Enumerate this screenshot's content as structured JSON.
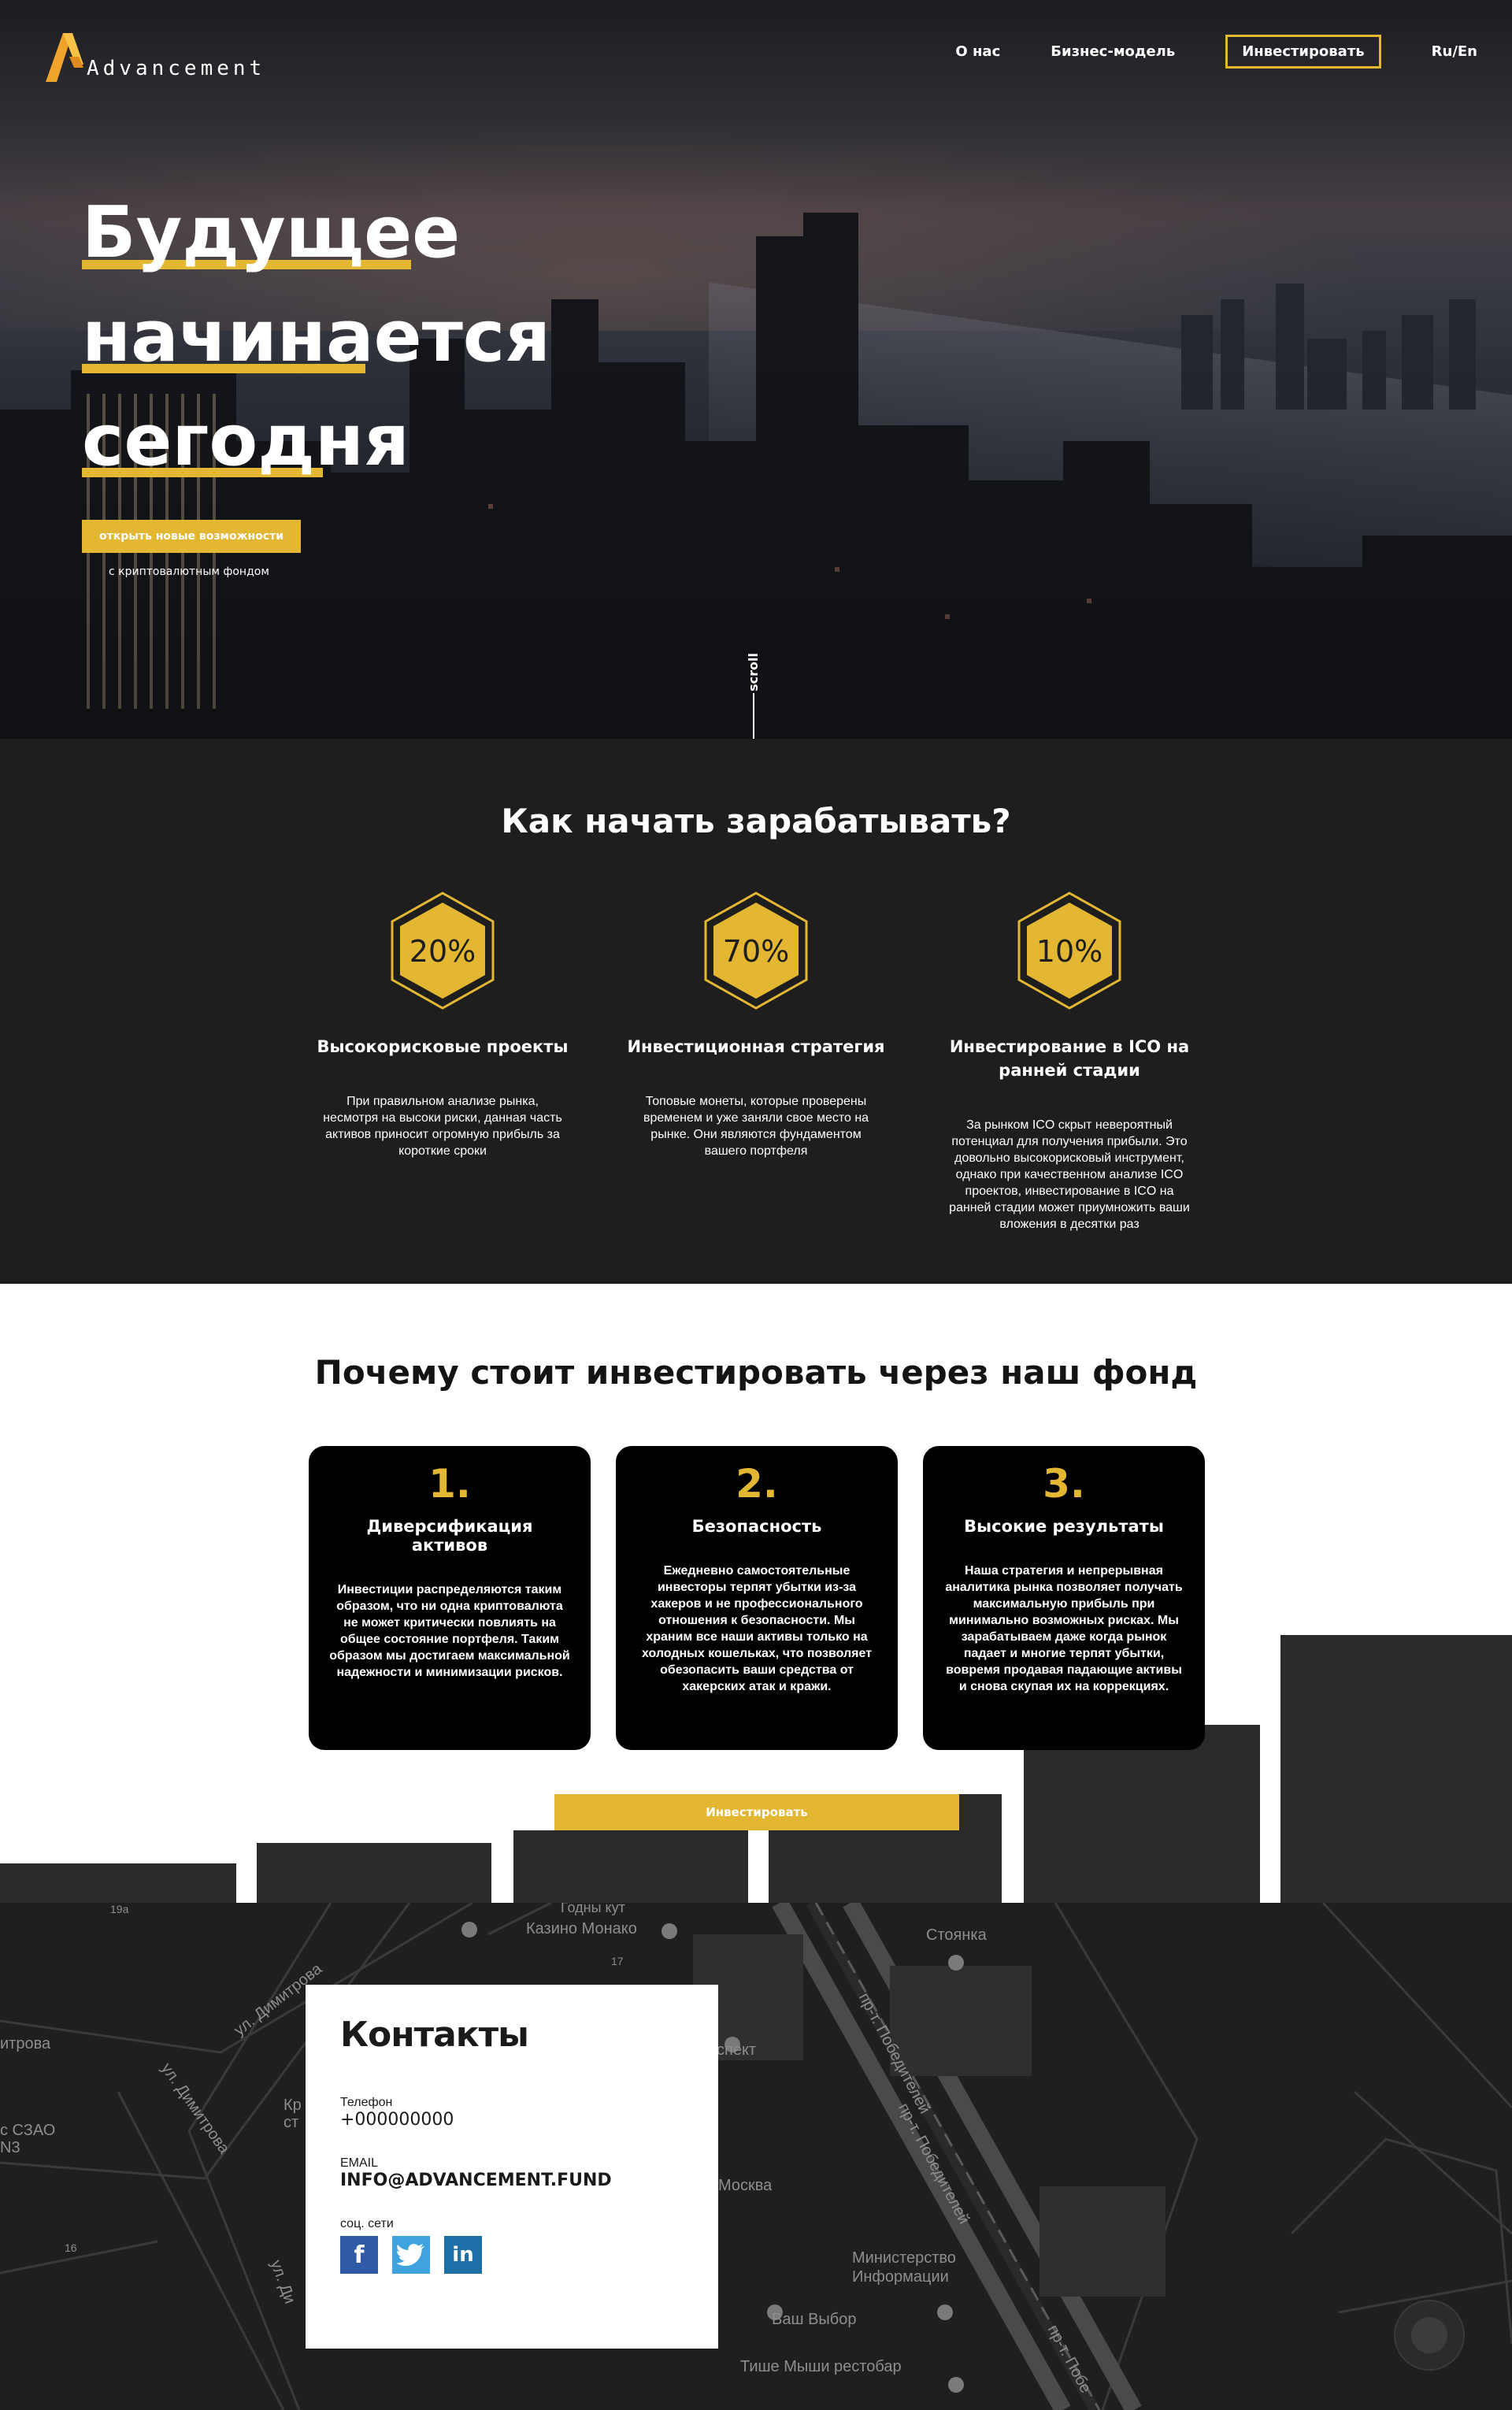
{
  "brand": {
    "name": "Advancement",
    "accent": "#e4b733"
  },
  "nav": {
    "about": "О нас",
    "business_model": "Бизнес-модель",
    "invest": "Инвестировать",
    "lang": "Ru/En"
  },
  "hero": {
    "line1": "Будущее",
    "line2": "начинается",
    "line3": "сегодня",
    "cta": "открыть новые возможности",
    "cta_sub": "с криптовалютным фондом",
    "scroll": "scroll"
  },
  "earn": {
    "title": "Как начать зарабатывать?",
    "items": [
      {
        "percent": "20%",
        "title": "Высокорисковые проекты",
        "desc": "При правильном анализе рынка, несмотря на высоки риски, данная часть активов приносит огромную прибыль за короткие сроки"
      },
      {
        "percent": "70%",
        "title": "Инвестиционная стратегия",
        "desc": "Топовые монеты, которые проверены временем и уже заняли свое место на рынке. Они являются фундаментом вашего портфеля"
      },
      {
        "percent": "10%",
        "title": "Инвестирование в ICO на ранней стадии",
        "desc": "За рынком ICO скрыт невероятный потенциал для получения прибыли. Это довольно высокорисковый инструмент, однако при качественном анализе ICO проектов, инвестирование в ICO на ранней стадии может приумножить ваши вложения в десятки раз"
      }
    ]
  },
  "why": {
    "title": "Почему стоит инвестировать через наш фонд",
    "cards": [
      {
        "num": "1.",
        "title": "Диверсификация активов",
        "desc": "Инвестиции распределяются таким образом, что ни одна криптовалюта не может критически повлиять на общее состояние портфеля. Таким образом мы достигаем максимальной надежности и минимизации рисков."
      },
      {
        "num": "2.",
        "title": "Безопасность",
        "desc": "Ежедневно самостоятельные инвесторы терпят убытки из-за хакеров и не профессионального отношения к безопасности. Мы храним все наши активы только на холодных кошельках, что позволяет обезопасить ваши средства от хакерских атак и кражи."
      },
      {
        "num": "3.",
        "title": "Высокие результаты",
        "desc": "Наша стратегия и непрерывная аналитика рынка позволяет получать максимальную прибыль при минимально возможных рисках. Мы зарабатываем даже когда рынок падает и многие терпят убытки, вовремя продавая падающие активы и снова скупая их на коррекциях."
      }
    ],
    "invest_button": "Инвестировать"
  },
  "map": {
    "labels": {
      "casino": "Казино Монако",
      "parking": "Стоянка",
      "moscow": "Москва",
      "ministry_1": "Министерство",
      "ministry_2": "Информации",
      "your_choice": "Ваш Выбор",
      "quiet_mice": "Тише Мыши рестобар",
      "dimitrova_1": "ул. Димитрова",
      "dimitrova_2": "ул. Димитрова",
      "dimitrova_3": "ул. Ди",
      "pobediteley_1": "пр-т. Победителей",
      "pobediteley_2": "пр-т. Победителей",
      "pobediteley_3": "пр-т. Побе",
      "szao_1": "с СЗАО",
      "szao_2": "N3",
      "itrova": "итрова",
      "prospect": "спект",
      "godny": "Годны кут",
      "n19a": "19а",
      "n17": "17",
      "n16": "16",
      "kr_1": "Кр",
      "kr_2": "ст"
    }
  },
  "contacts": {
    "title": "Контакты",
    "phone_label": "Телефон",
    "phone": "+000000000",
    "email_label": "EMAIL",
    "email": "INFO@ADVANCEMENT.FUND",
    "social_label": "соц. сети",
    "social": [
      "facebook-icon",
      "twitter-icon",
      "linkedin-icon"
    ]
  }
}
